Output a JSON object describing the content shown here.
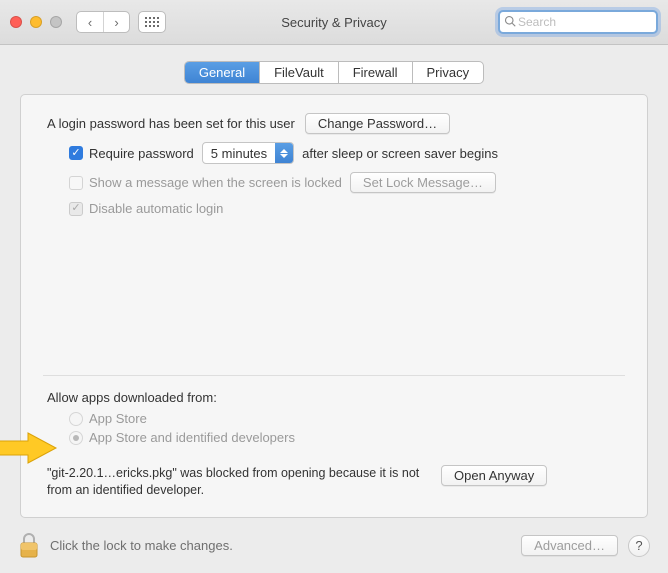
{
  "window": {
    "title": "Security & Privacy"
  },
  "search": {
    "placeholder": "Search"
  },
  "tabs": [
    "General",
    "FileVault",
    "Firewall",
    "Privacy"
  ],
  "login": {
    "password_set_label": "A login password has been set for this user",
    "change_password_btn": "Change Password…",
    "require_password_label": "Require password",
    "require_password_delay": "5 minutes",
    "after_sleep_label": "after sleep or screen saver begins",
    "show_message_label": "Show a message when the screen is locked",
    "set_lock_message_btn": "Set Lock Message…",
    "disable_auto_login_label": "Disable automatic login"
  },
  "allow": {
    "heading": "Allow apps downloaded from:",
    "option_appstore": "App Store",
    "option_identified": "App Store and identified developers"
  },
  "blocked": {
    "message": "\"git-2.20.1…ericks.pkg\" was blocked from opening because it is not from an identified developer.",
    "open_anyway_btn": "Open Anyway"
  },
  "footer": {
    "lock_text": "Click the lock to make changes.",
    "advanced_btn": "Advanced…"
  }
}
